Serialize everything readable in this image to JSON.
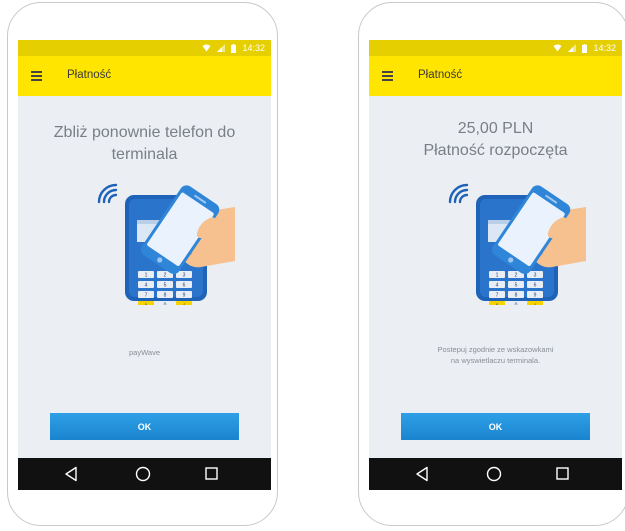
{
  "status_bar": {
    "time": "14:32"
  },
  "screens": [
    {
      "app_title": "Płatność",
      "headline_lines": [
        "Zbliż ponownie telefon do",
        "terminala"
      ],
      "subtext_lines": [
        "payWave"
      ],
      "ok_label": "OK"
    },
    {
      "app_title": "Płatność",
      "headline_lines": [
        "25,00 PLN",
        "Płatność rozpoczęta"
      ],
      "subtext_lines": [
        "Postepuj zgodnie ze wskazowkami",
        "na wyswietlaczu terminala."
      ],
      "ok_label": "OK"
    }
  ],
  "terminal_keys": [
    "1",
    "2",
    "3",
    "4",
    "5",
    "6",
    "7",
    "8",
    "9",
    "×",
    "0",
    "✓"
  ],
  "colors": {
    "status_bar": "#e5cf00",
    "app_bar": "#ffe500",
    "screen_bg": "#ebeef2",
    "ok_button": "#1f8fd9",
    "terminal": "#1e63b8",
    "nav_bar": "#111111"
  }
}
